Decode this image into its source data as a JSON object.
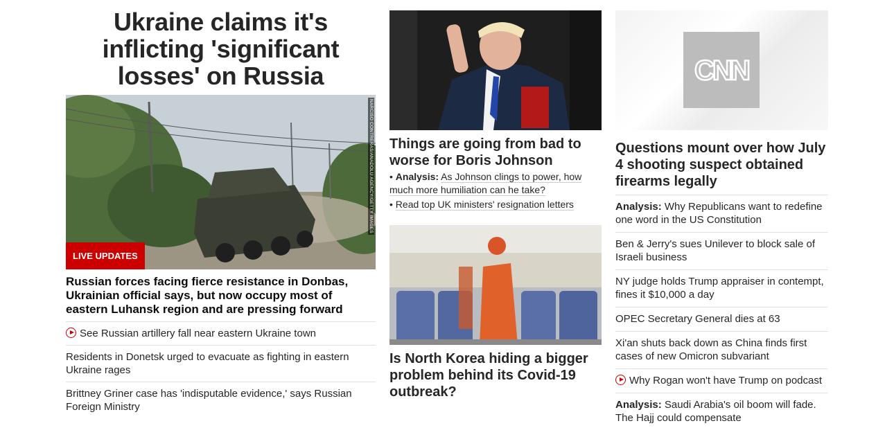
{
  "lead": {
    "title": "Ukraine claims it's inflicting 'significant losses' on Russia",
    "photo_credit": "NARCISO CONTRERAS/ANADOLU AGENCY/GETTY IMAGES",
    "badge": "LIVE UPDATES",
    "headline": "Russian forces facing fierce resistance in Donbas, Ukrainian official says, but now occupy most of eastern Luhansk region and are pressing forward",
    "links": [
      {
        "text": "See Russian artillery fall near eastern Ukraine town",
        "icon": "play-icon"
      },
      {
        "text": "Residents in Donetsk urged to evacuate as fighting in eastern Ukraine rages"
      },
      {
        "text": "Brittney Griner case has 'indisputable evidence,' says Russian Foreign Ministry"
      }
    ]
  },
  "middle": {
    "story1": {
      "headline": "Things are going from bad to worse for Boris Johnson",
      "bullet1_prefix": "Analysis:",
      "bullet1_text": "As Johnson clings to power, how much more humiliation can he take?",
      "bullet2_text": "Read top UK ministers' resignation letters"
    },
    "story2": {
      "headline": "Is North Korea hiding a bigger problem behind its Covid-19 outbreak?"
    }
  },
  "right": {
    "logo_text": "CNN",
    "headline": "Questions mount over how July 4 shooting suspect obtained firearms legally",
    "links": [
      {
        "prefix": "Analysis:",
        "text": "Why Republicans want to redefine one word in the US Constitution"
      },
      {
        "text": "Ben & Jerry's sues Unilever to block sale of Israeli business"
      },
      {
        "text": "NY judge holds Trump appraiser in contempt, fines it $10,000 a day"
      },
      {
        "text": "OPEC Secretary General dies at 63"
      },
      {
        "text": "Xi'an shuts back down as China finds first cases of new Omicron subvariant"
      },
      {
        "text": "Why Rogan won't have Trump on podcast",
        "icon": "play-icon"
      },
      {
        "prefix": "Analysis:",
        "text": "Saudi Arabia's oil boom will fade. The Hajj could compensate"
      }
    ]
  },
  "colors": {
    "accent": "#cc0000",
    "text": "#262626",
    "divider": "#e0e0e0"
  }
}
